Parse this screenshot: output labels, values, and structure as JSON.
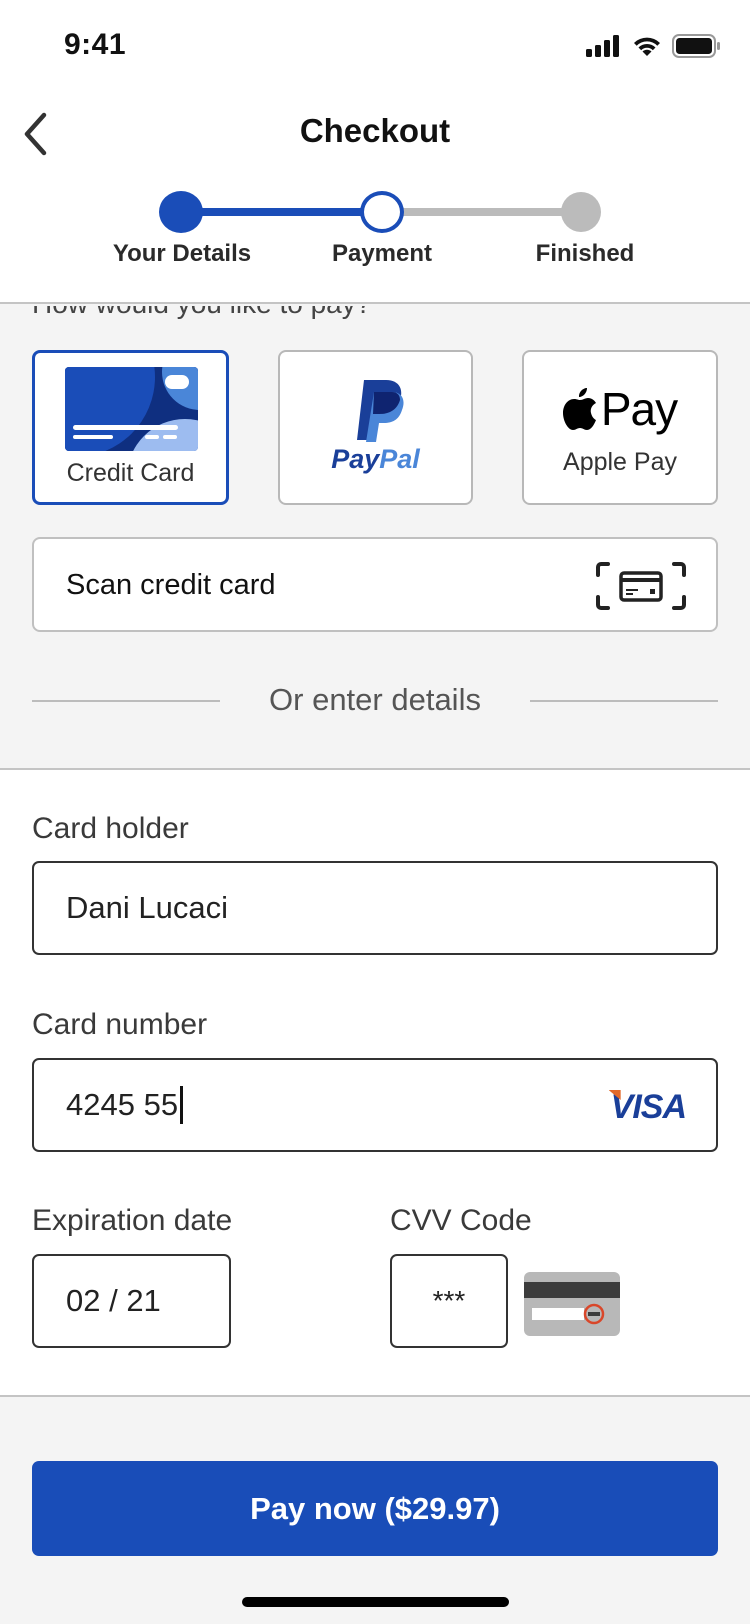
{
  "status_bar": {
    "time": "9:41",
    "icons": [
      "signal-icon",
      "wifi-icon",
      "battery-icon"
    ]
  },
  "header": {
    "title": "Checkout",
    "back_icon": "chevron-left-icon"
  },
  "stepper": {
    "steps": [
      {
        "label": "Your Details",
        "state": "completed"
      },
      {
        "label": "Payment",
        "state": "current"
      },
      {
        "label": "Finished",
        "state": "upcoming"
      }
    ],
    "colors": {
      "active": "#1a4db8",
      "inactive": "#bbbbbb"
    }
  },
  "payment": {
    "question": "How would you like to pay?",
    "options": [
      {
        "label": "Credit Card",
        "icon": "credit-card-icon",
        "selected": true
      },
      {
        "label": "PayPal",
        "icon": "paypal-logo",
        "selected": false,
        "logo_text_a": "Pay",
        "logo_text_b": "Pal"
      },
      {
        "label": "Apple Pay",
        "icon": "apple-pay-logo",
        "selected": false,
        "logo_text": "Pay"
      }
    ],
    "scan_label": "Scan credit card",
    "scan_icon": "scan-card-icon",
    "divider_text": "Or enter details"
  },
  "form": {
    "card_holder": {
      "label": "Card holder",
      "value": "Dani Lucaci"
    },
    "card_number": {
      "label": "Card number",
      "value": "4245 55",
      "brand": "VISA"
    },
    "expiration": {
      "label": "Expiration date",
      "value": "02 / 21"
    },
    "cvv": {
      "label": "CVV Code",
      "value": "***",
      "hint_icon": "card-back-cvv-icon"
    }
  },
  "actions": {
    "pay_label": "Pay now ($29.97)"
  },
  "colors": {
    "primary": "#194db8",
    "background": "#f4f4f4",
    "cvv_highlight": "#d9472a"
  }
}
